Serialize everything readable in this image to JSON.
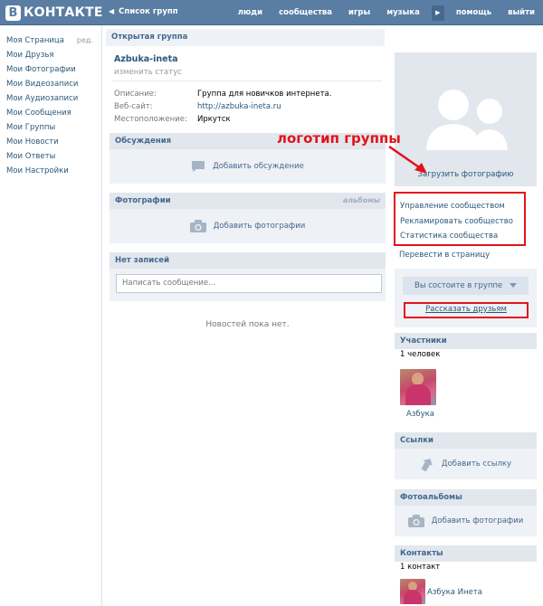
{
  "topbar": {
    "logo_letter": "В",
    "logo_text": "КОНТАКТЕ",
    "back_arrow": "◀",
    "back_label": "Список групп",
    "nav": [
      "люди",
      "сообщества",
      "игры",
      "музыка",
      "помощь",
      "выйти"
    ],
    "play_icon": "▶"
  },
  "left_menu": {
    "items": [
      "Моя Страница",
      "Мои Друзья",
      "Мои Фотографии",
      "Мои Видеозаписи",
      "Мои Аудиозаписи",
      "Мои Сообщения",
      "Мои Группы",
      "Мои Новости",
      "Мои Ответы",
      "Мои Настройки"
    ],
    "edit_label": "ред."
  },
  "group": {
    "type_label": "Открытая группа",
    "name": "Azbuka-ineta",
    "status": "изменить статус",
    "info": [
      {
        "label": "Описание:",
        "value": "Группа для новичков интернета."
      },
      {
        "label": "Веб-сайт:",
        "value": "http://azbuka-ineta.ru"
      },
      {
        "label": "Местоположение:",
        "value": "Иркутск"
      }
    ]
  },
  "sections": {
    "discussions": {
      "title": "Обсуждения",
      "action": "Добавить обсуждение"
    },
    "photos": {
      "title": "Фотографии",
      "right": "альбомы",
      "action": "Добавить фотографии"
    },
    "wall": {
      "title": "Нет записей",
      "placeholder": "Написать сообщение...",
      "empty": "Новостей пока нет."
    }
  },
  "annotation": {
    "text": "логотип группы",
    "color": "#e3121b"
  },
  "right": {
    "upload_label": "Загрузить фотографию",
    "manage": [
      "Управление сообществом",
      "Рекламировать сообщество",
      "Статистика сообщества"
    ],
    "transfer_label": "Перевести в страницу",
    "member_button": "Вы состоите в группе",
    "tell_friends": "Рассказать друзьям",
    "members": {
      "title": "Участники",
      "count": "1 человек",
      "name": "Азбука"
    },
    "links": {
      "title": "Ссылки",
      "action": "Добавить ссылку"
    },
    "albums": {
      "title": "Фотоальбомы",
      "action": "Добавить фотографии"
    },
    "contacts": {
      "title": "Контакты",
      "count": "1 контакт",
      "name": "Азбука Инета"
    }
  },
  "colors": {
    "topbar": "#597da3",
    "link": "#2b587a",
    "section_header": "#e1e7ed",
    "highlight": "#e3121b"
  }
}
